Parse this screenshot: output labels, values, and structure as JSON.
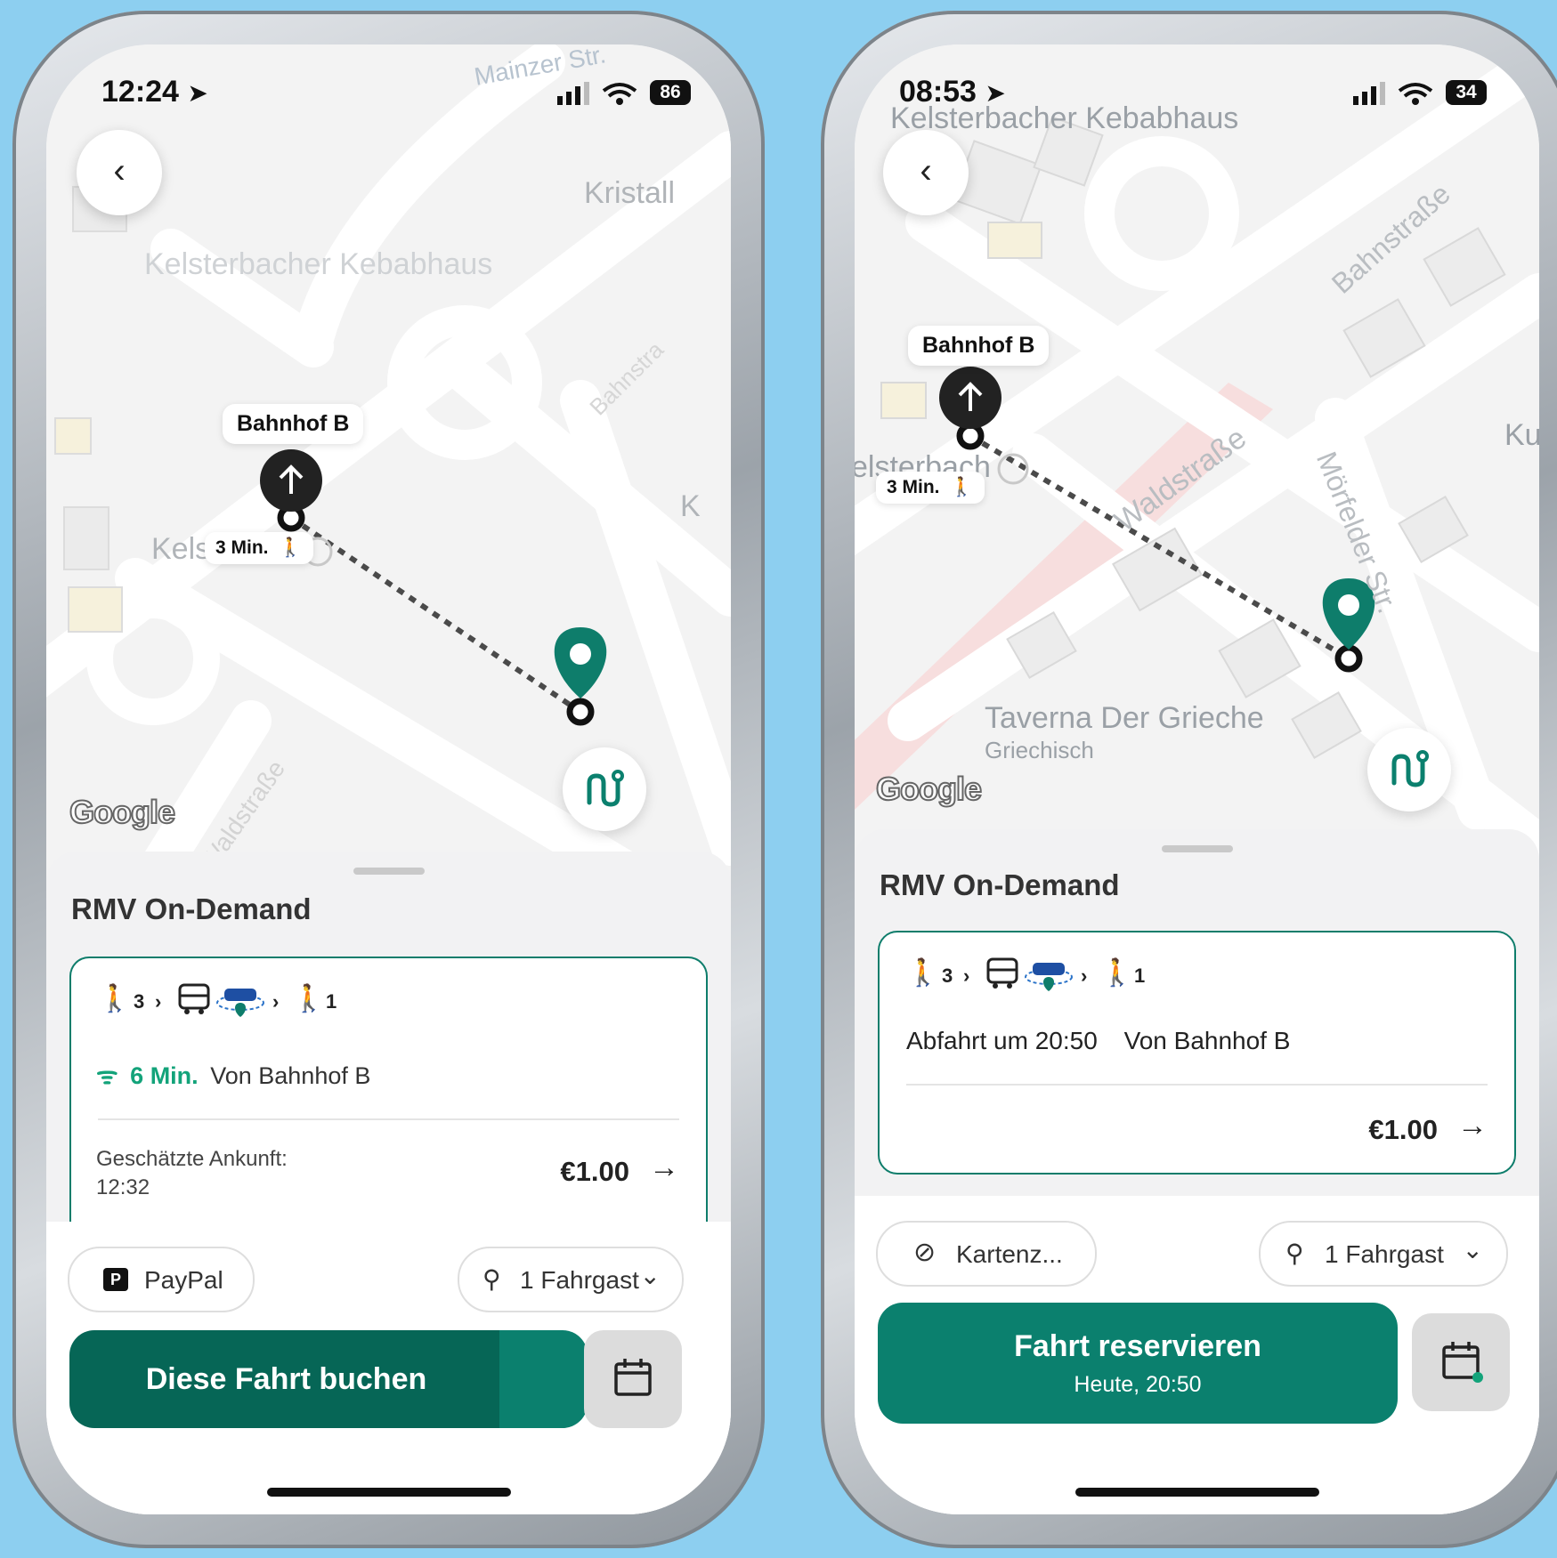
{
  "left": {
    "status": {
      "time": "12:24",
      "battery": "86"
    },
    "map": {
      "labels": [
        "Mainzer Str.",
        "Kristall",
        "Kelsterbacher Kebabhaus",
        "Bahnstra",
        "Kels",
        "K",
        "Waldstraße"
      ],
      "stop": "Bahnhof B",
      "walk": "3 Min."
    },
    "sheet": {
      "title": "RMV On-Demand",
      "journey": {
        "walk_before": "3",
        "walk_after": "1"
      },
      "live_eta": "6 Min.",
      "from": "Von Bahnhof B",
      "arrival_label": "Geschätzte Ankunft:",
      "arrival_time": "12:32",
      "price": "€1.00",
      "payment": "PayPal",
      "passengers": "1 Fahrgast",
      "book_button": "Diese Fahrt buchen"
    }
  },
  "right": {
    "status": {
      "time": "08:53",
      "battery": "34"
    },
    "map": {
      "labels": [
        "Kelsterbacher Kebabhaus",
        "Bahnstraße",
        "Waldstraße",
        "Mörfelder Str.",
        "elsterbach",
        "Taverna Der Grieche",
        "Griechisch",
        "Ku"
      ],
      "stop": "Bahnhof B",
      "walk": "3 Min."
    },
    "sheet": {
      "title": "RMV On-Demand",
      "journey": {
        "walk_before": "3",
        "walk_after": "1"
      },
      "departure": "Abfahrt um 20:50",
      "from": "Von Bahnhof B",
      "price": "€1.00",
      "payment": "Kartenz...",
      "passengers": "1 Fahrgast",
      "book_button": "Fahrt reservieren",
      "book_sub": "Heute, 20:50"
    }
  },
  "brand": "Google",
  "colors": {
    "accent": "#0b806e",
    "accent_dark": "#066656",
    "marker": "#0e7d6b",
    "live": "#13a37a"
  }
}
